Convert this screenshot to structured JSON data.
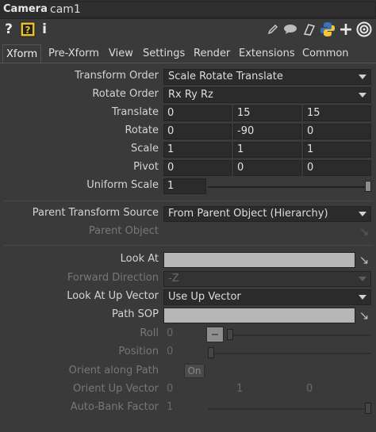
{
  "header": {
    "op_type": "Camera",
    "op_name": "cam1"
  },
  "toolbar": {
    "icons": [
      "help-icon",
      "help-wiki-icon",
      "info-icon",
      "edit-icon",
      "comment-icon",
      "bookmark-icon",
      "python-icon",
      "add-icon",
      "target-icon"
    ],
    "help_glyph": "?",
    "info_glyph": "i"
  },
  "tabs": [
    {
      "label": "Xform",
      "active": true
    },
    {
      "label": "Pre-Xform"
    },
    {
      "label": "View"
    },
    {
      "label": "Settings"
    },
    {
      "label": "Render"
    },
    {
      "label": "Extensions"
    },
    {
      "label": "Common"
    }
  ],
  "params": {
    "transform_order": {
      "label": "Transform Order",
      "value": "Scale Rotate Translate"
    },
    "rotate_order": {
      "label": "Rotate Order",
      "value": "Rx Ry Rz"
    },
    "translate": {
      "label": "Translate",
      "values": [
        "0",
        "15",
        "15"
      ]
    },
    "rotate": {
      "label": "Rotate",
      "values": [
        "0",
        "-90",
        "0"
      ]
    },
    "scale": {
      "label": "Scale",
      "values": [
        "1",
        "1",
        "1"
      ]
    },
    "pivot": {
      "label": "Pivot",
      "values": [
        "0",
        "0",
        "0"
      ]
    },
    "uniform_scale": {
      "label": "Uniform Scale",
      "value": "1",
      "slider_fraction": 1.0
    },
    "parent_transform_source": {
      "label": "Parent Transform Source",
      "value": "From Parent Object (Hierarchy)"
    },
    "parent_object": {
      "label": "Parent Object",
      "value": ""
    },
    "look_at": {
      "label": "Look At",
      "value": ""
    },
    "forward_direction": {
      "label": "Forward Direction",
      "value": "-Z"
    },
    "look_at_up_vector": {
      "label": "Look At Up Vector",
      "value": "Use Up Vector"
    },
    "path_sop": {
      "label": "Path SOP",
      "value": ""
    },
    "roll": {
      "label": "Roll",
      "value": "0"
    },
    "position": {
      "label": "Position",
      "value": "0"
    },
    "orient_along_path": {
      "label": "Orient along Path",
      "value": "On"
    },
    "orient_up_vector": {
      "label": "Orient Up Vector",
      "values": [
        "0",
        "1",
        "0"
      ]
    },
    "auto_bank_factor": {
      "label": "Auto-Bank Factor",
      "value": "1",
      "slider_fraction": 1.0
    }
  }
}
